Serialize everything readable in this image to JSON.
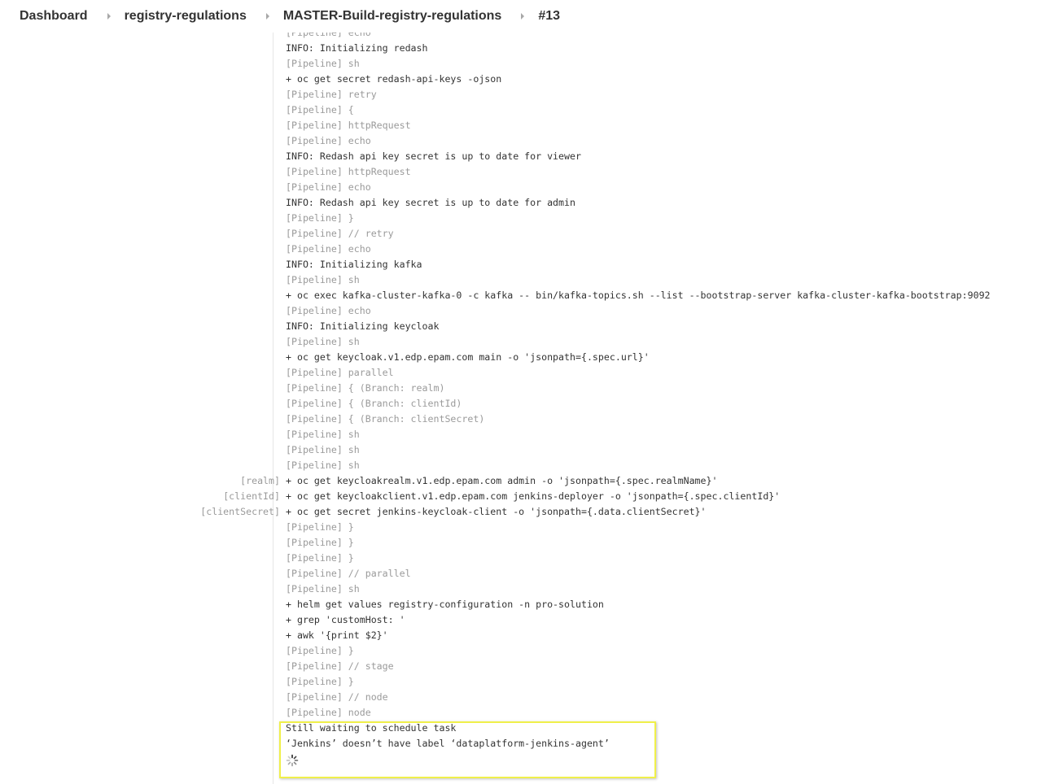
{
  "breadcrumb": {
    "items": [
      {
        "label": "Dashboard"
      },
      {
        "label": "registry-regulations"
      },
      {
        "label": "MASTER-Build-registry-regulations"
      },
      {
        "label": "#13"
      }
    ]
  },
  "console": {
    "lines": [
      {
        "branch": "",
        "text": "[Pipeline] echo",
        "kind": "pipeline"
      },
      {
        "branch": "",
        "text": "INFO: Initializing redash",
        "kind": "output"
      },
      {
        "branch": "",
        "text": "[Pipeline] sh",
        "kind": "pipeline"
      },
      {
        "branch": "",
        "text": "+ oc get secret redash-api-keys -ojson",
        "kind": "output"
      },
      {
        "branch": "",
        "text": "[Pipeline] retry",
        "kind": "pipeline"
      },
      {
        "branch": "",
        "text": "[Pipeline] {",
        "kind": "pipeline"
      },
      {
        "branch": "",
        "text": "[Pipeline] httpRequest",
        "kind": "pipeline"
      },
      {
        "branch": "",
        "text": "[Pipeline] echo",
        "kind": "pipeline"
      },
      {
        "branch": "",
        "text": "INFO: Redash api key secret is up to date for viewer",
        "kind": "output"
      },
      {
        "branch": "",
        "text": "[Pipeline] httpRequest",
        "kind": "pipeline"
      },
      {
        "branch": "",
        "text": "[Pipeline] echo",
        "kind": "pipeline"
      },
      {
        "branch": "",
        "text": "INFO: Redash api key secret is up to date for admin",
        "kind": "output"
      },
      {
        "branch": "",
        "text": "[Pipeline] }",
        "kind": "pipeline"
      },
      {
        "branch": "",
        "text": "[Pipeline] // retry",
        "kind": "pipeline"
      },
      {
        "branch": "",
        "text": "[Pipeline] echo",
        "kind": "pipeline"
      },
      {
        "branch": "",
        "text": "INFO: Initializing kafka",
        "kind": "output"
      },
      {
        "branch": "",
        "text": "[Pipeline] sh",
        "kind": "pipeline"
      },
      {
        "branch": "",
        "text": "+ oc exec kafka-cluster-kafka-0 -c kafka -- bin/kafka-topics.sh --list --bootstrap-server kafka-cluster-kafka-bootstrap:9092",
        "kind": "output"
      },
      {
        "branch": "",
        "text": "[Pipeline] echo",
        "kind": "pipeline"
      },
      {
        "branch": "",
        "text": "INFO: Initializing keycloak",
        "kind": "output"
      },
      {
        "branch": "",
        "text": "[Pipeline] sh",
        "kind": "pipeline"
      },
      {
        "branch": "",
        "text": "+ oc get keycloak.v1.edp.epam.com main -o 'jsonpath={.spec.url}'",
        "kind": "output"
      },
      {
        "branch": "",
        "text": "[Pipeline] parallel",
        "kind": "pipeline"
      },
      {
        "branch": "",
        "text": "[Pipeline] { (Branch: realm)",
        "kind": "pipeline"
      },
      {
        "branch": "",
        "text": "[Pipeline] { (Branch: clientId)",
        "kind": "pipeline"
      },
      {
        "branch": "",
        "text": "[Pipeline] { (Branch: clientSecret)",
        "kind": "pipeline"
      },
      {
        "branch": "",
        "text": "[Pipeline] sh",
        "kind": "pipeline"
      },
      {
        "branch": "",
        "text": "[Pipeline] sh",
        "kind": "pipeline"
      },
      {
        "branch": "",
        "text": "[Pipeline] sh",
        "kind": "pipeline"
      },
      {
        "branch": "[realm]",
        "text": "+ oc get keycloakrealm.v1.edp.epam.com admin -o 'jsonpath={.spec.realmName}'",
        "kind": "output"
      },
      {
        "branch": "[clientId]",
        "text": "+ oc get keycloakclient.v1.edp.epam.com jenkins-deployer -o 'jsonpath={.spec.clientId}'",
        "kind": "output"
      },
      {
        "branch": "[clientSecret]",
        "text": "+ oc get secret jenkins-keycloak-client -o 'jsonpath={.data.clientSecret}'",
        "kind": "output"
      },
      {
        "branch": "",
        "text": "[Pipeline] }",
        "kind": "pipeline"
      },
      {
        "branch": "",
        "text": "[Pipeline] }",
        "kind": "pipeline"
      },
      {
        "branch": "",
        "text": "[Pipeline] }",
        "kind": "pipeline"
      },
      {
        "branch": "",
        "text": "[Pipeline] // parallel",
        "kind": "pipeline"
      },
      {
        "branch": "",
        "text": "[Pipeline] sh",
        "kind": "pipeline"
      },
      {
        "branch": "",
        "text": "+ helm get values registry-configuration -n pro-solution",
        "kind": "output"
      },
      {
        "branch": "",
        "text": "+ grep 'customHost: '",
        "kind": "output"
      },
      {
        "branch": "",
        "text": "+ awk '{print $2}'",
        "kind": "output"
      },
      {
        "branch": "",
        "text": "[Pipeline] }",
        "kind": "pipeline"
      },
      {
        "branch": "",
        "text": "[Pipeline] // stage",
        "kind": "pipeline"
      },
      {
        "branch": "",
        "text": "[Pipeline] }",
        "kind": "pipeline"
      },
      {
        "branch": "",
        "text": "[Pipeline] // node",
        "kind": "pipeline"
      },
      {
        "branch": "",
        "text": "[Pipeline] node",
        "kind": "pipeline"
      },
      {
        "branch": "",
        "text": "Still waiting to schedule task",
        "kind": "output"
      },
      {
        "branch": "",
        "text": "‘Jenkins’ doesn’t have label ‘dataplatform-jenkins-agent’",
        "kind": "output"
      }
    ]
  },
  "colors": {
    "highlight_border": "#f0f04a",
    "pipeline_text": "#9a9a9a",
    "output_text": "#333333"
  },
  "icons": {
    "spinner": "loading-spinner-icon"
  }
}
